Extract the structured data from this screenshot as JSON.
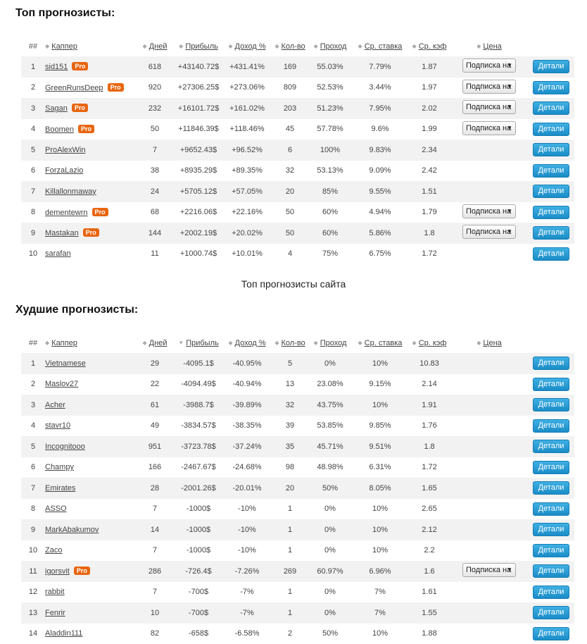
{
  "top": {
    "title": "Топ прогнозисты:",
    "caption": "Топ прогнозисты сайта",
    "headers": {
      "num": "##",
      "tipster": "Каппер",
      "days": "Дней",
      "profit": "Прибыль",
      "income": "Доход %",
      "count": "Кол-во",
      "pass": "Проход",
      "avg_stake": "Ср. ставка",
      "avg_odds": "Ср. кэф",
      "price": "Цена"
    },
    "rows": [
      {
        "n": "1",
        "name": "sid151",
        "pro": "Pro",
        "days": "618",
        "profit": "+43140.72$",
        "income": "+431.41%",
        "count": "169",
        "pass": "55.03%",
        "stake": "7.79%",
        "odds": "1.87",
        "sub": "Подписка на",
        "details": "Детали"
      },
      {
        "n": "2",
        "name": "GreenRunsDeep",
        "pro": "Pro",
        "days": "920",
        "profit": "+27306.25$",
        "income": "+273.06%",
        "count": "809",
        "pass": "52.53%",
        "stake": "3.44%",
        "odds": "1.97",
        "sub": "Подписка на",
        "details": "Детали"
      },
      {
        "n": "3",
        "name": "Sagan",
        "pro": "Pro",
        "days": "232",
        "profit": "+16101.72$",
        "income": "+161.02%",
        "count": "203",
        "pass": "51.23%",
        "stake": "7.95%",
        "odds": "2.02",
        "sub": "Подписка на",
        "details": "Детали"
      },
      {
        "n": "4",
        "name": "Boomen",
        "pro": "Pro",
        "days": "50",
        "profit": "+11846.39$",
        "income": "+118.46%",
        "count": "45",
        "pass": "57.78%",
        "stake": "9.6%",
        "odds": "1.99",
        "sub": "Подписка на",
        "details": "Детали"
      },
      {
        "n": "5",
        "name": "ProAlexWin",
        "pro": "",
        "days": "7",
        "profit": "+9652.43$",
        "income": "+96.52%",
        "count": "6",
        "pass": "100%",
        "stake": "9.83%",
        "odds": "2.34",
        "sub": "",
        "details": "Детали"
      },
      {
        "n": "6",
        "name": "ForzaLazio",
        "pro": "",
        "days": "38",
        "profit": "+8935.29$",
        "income": "+89.35%",
        "count": "32",
        "pass": "53.13%",
        "stake": "9.09%",
        "odds": "2.42",
        "sub": "",
        "details": "Детали"
      },
      {
        "n": "7",
        "name": "Killallonmaway",
        "pro": "",
        "days": "24",
        "profit": "+5705.12$",
        "income": "+57.05%",
        "count": "20",
        "pass": "85%",
        "stake": "9.55%",
        "odds": "1.51",
        "sub": "",
        "details": "Детали"
      },
      {
        "n": "8",
        "name": "dementewrn",
        "pro": "Pro",
        "days": "68",
        "profit": "+2216.06$",
        "income": "+22.16%",
        "count": "50",
        "pass": "60%",
        "stake": "4.94%",
        "odds": "1.79",
        "sub": "Подписка на",
        "details": "Детали"
      },
      {
        "n": "9",
        "name": "Mastakan",
        "pro": "Pro",
        "days": "144",
        "profit": "+2002.19$",
        "income": "+20.02%",
        "count": "50",
        "pass": "60%",
        "stake": "5.86%",
        "odds": "1.8",
        "sub": "Подписка на",
        "details": "Детали"
      },
      {
        "n": "10",
        "name": "sarafan",
        "pro": "",
        "days": "11",
        "profit": "+1000.74$",
        "income": "+10.01%",
        "count": "4",
        "pass": "75%",
        "stake": "6.75%",
        "odds": "1.72",
        "sub": "",
        "details": "Детали"
      }
    ]
  },
  "worst": {
    "title": "Худшие прогнозисты:",
    "headers": {
      "num": "##",
      "tipster": "Каппер",
      "days": "Дней",
      "profit": "Прибыль",
      "income": "Доход %",
      "count": "Кол-во",
      "pass": "Проход",
      "avg_stake": "Ср. ставка",
      "avg_odds": "Ср. кэф",
      "price": "Цена"
    },
    "rows": [
      {
        "n": "1",
        "name": "Vietnamese",
        "pro": "",
        "days": "29",
        "profit": "-4095.1$",
        "income": "-40.95%",
        "count": "5",
        "pass": "0%",
        "stake": "10%",
        "odds": "10.83",
        "sub": "",
        "details": "Детали"
      },
      {
        "n": "2",
        "name": "Maslov27",
        "pro": "",
        "days": "22",
        "profit": "-4094.49$",
        "income": "-40.94%",
        "count": "13",
        "pass": "23.08%",
        "stake": "9.15%",
        "odds": "2.14",
        "sub": "",
        "details": "Детали"
      },
      {
        "n": "3",
        "name": "Acher",
        "pro": "",
        "days": "61",
        "profit": "-3988.7$",
        "income": "-39.89%",
        "count": "32",
        "pass": "43.75%",
        "stake": "10%",
        "odds": "1.91",
        "sub": "",
        "details": "Детали"
      },
      {
        "n": "4",
        "name": "stavr10",
        "pro": "",
        "days": "49",
        "profit": "-3834.57$",
        "income": "-38.35%",
        "count": "39",
        "pass": "53.85%",
        "stake": "9.85%",
        "odds": "1.76",
        "sub": "",
        "details": "Детали"
      },
      {
        "n": "5",
        "name": "Incognitooo",
        "pro": "",
        "days": "951",
        "profit": "-3723.78$",
        "income": "-37.24%",
        "count": "35",
        "pass": "45.71%",
        "stake": "9.51%",
        "odds": "1.8",
        "sub": "",
        "details": "Детали"
      },
      {
        "n": "6",
        "name": "Champy",
        "pro": "",
        "days": "166",
        "profit": "-2467.67$",
        "income": "-24.68%",
        "count": "98",
        "pass": "48.98%",
        "stake": "6.31%",
        "odds": "1.72",
        "sub": "",
        "details": "Детали"
      },
      {
        "n": "7",
        "name": "Emirates",
        "pro": "",
        "days": "28",
        "profit": "-2001.26$",
        "income": "-20.01%",
        "count": "20",
        "pass": "50%",
        "stake": "8.05%",
        "odds": "1.65",
        "sub": "",
        "details": "Детали"
      },
      {
        "n": "8",
        "name": "ASSO",
        "pro": "",
        "days": "7",
        "profit": "-1000$",
        "income": "-10%",
        "count": "1",
        "pass": "0%",
        "stake": "10%",
        "odds": "2.65",
        "sub": "",
        "details": "Детали"
      },
      {
        "n": "9",
        "name": "MarkAbakumov",
        "pro": "",
        "days": "14",
        "profit": "-1000$",
        "income": "-10%",
        "count": "1",
        "pass": "0%",
        "stake": "10%",
        "odds": "2.12",
        "sub": "",
        "details": "Детали"
      },
      {
        "n": "10",
        "name": "Zaco",
        "pro": "",
        "days": "7",
        "profit": "-1000$",
        "income": "-10%",
        "count": "1",
        "pass": "0%",
        "stake": "10%",
        "odds": "2.2",
        "sub": "",
        "details": "Детали"
      },
      {
        "n": "11",
        "name": "igorsvit",
        "pro": "Pro",
        "days": "286",
        "profit": "-726.4$",
        "income": "-7.26%",
        "count": "269",
        "pass": "60.97%",
        "stake": "6.96%",
        "odds": "1.6",
        "sub": "Подписка на",
        "details": "Детали"
      },
      {
        "n": "12",
        "name": "rabbit",
        "pro": "",
        "days": "7",
        "profit": "-700$",
        "income": "-7%",
        "count": "1",
        "pass": "0%",
        "stake": "7%",
        "odds": "1.61",
        "sub": "",
        "details": "Детали"
      },
      {
        "n": "13",
        "name": "Fenrir",
        "pro": "",
        "days": "10",
        "profit": "-700$",
        "income": "-7%",
        "count": "1",
        "pass": "0%",
        "stake": "7%",
        "odds": "1.55",
        "sub": "",
        "details": "Детали"
      },
      {
        "n": "14",
        "name": "Aladdin111",
        "pro": "",
        "days": "82",
        "profit": "-658$",
        "income": "-6.58%",
        "count": "2",
        "pass": "50%",
        "stake": "10%",
        "odds": "1.88",
        "sub": "",
        "details": "Детали"
      }
    ]
  },
  "colors": {
    "positive": "#2a8a1f",
    "negative": "#d61b1b",
    "pro_badge": "#e8650f",
    "details_button": "#2a9fd8"
  }
}
